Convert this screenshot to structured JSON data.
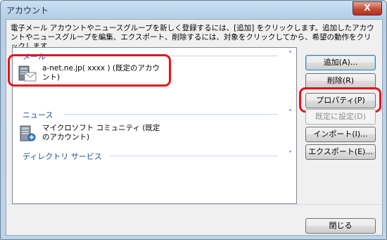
{
  "window": {
    "title": "アカウント",
    "close_label": "X"
  },
  "description": "電子メール アカウントやニュースグループを新しく登録するには、[追加] をクリックします。追加したアカウントやニュースグループを編集、エクスポート、削除するには、対象をクリックしてから、希望の動作をクリックします。",
  "groups": [
    {
      "label": "メール",
      "chevron": "˄"
    },
    {
      "label": "ニュース",
      "chevron": "˄"
    },
    {
      "label": "ディレクトリ サービス",
      "chevron": "˅"
    }
  ],
  "accounts": {
    "mail": "a-net.ne.jp( xxxx ) (既定のアカウント)",
    "news": "マイクロソフト コミュニティ (既定のアカウント)"
  },
  "buttons": {
    "add": "追加(A)...",
    "remove": "削除(R)",
    "properties": "プロパティ(P)",
    "set_default": "既定に設定(D)",
    "import": "インポート(I)...",
    "export": "エクスポート(E)...",
    "close": "閉じる"
  },
  "colors": {
    "annotation": "#e8131d",
    "group_text": "#1e4e9c"
  }
}
